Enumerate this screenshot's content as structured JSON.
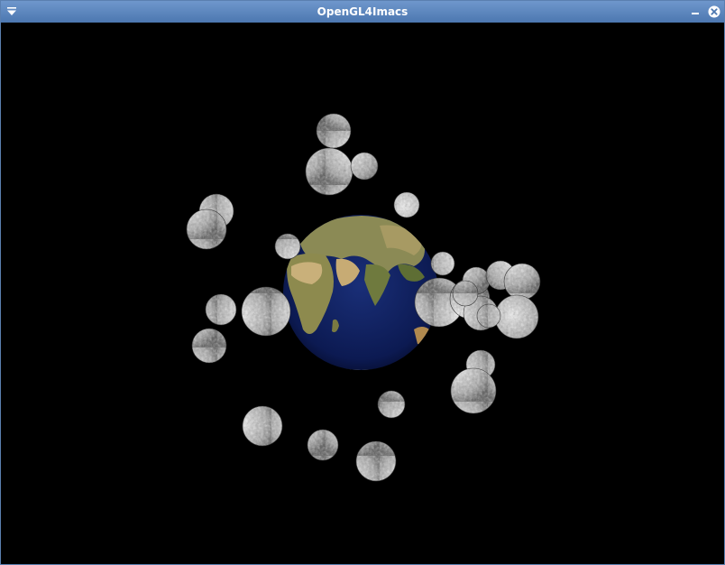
{
  "window": {
    "title": "OpenGL4Imacs",
    "titlebar_color": "#5b86bf",
    "icons": {
      "menu": "window-menu-icon",
      "minimize": "minimize-icon",
      "close": "close-icon"
    }
  },
  "scene": {
    "background": "#000000",
    "planet": "earth",
    "moon_count": 26
  }
}
